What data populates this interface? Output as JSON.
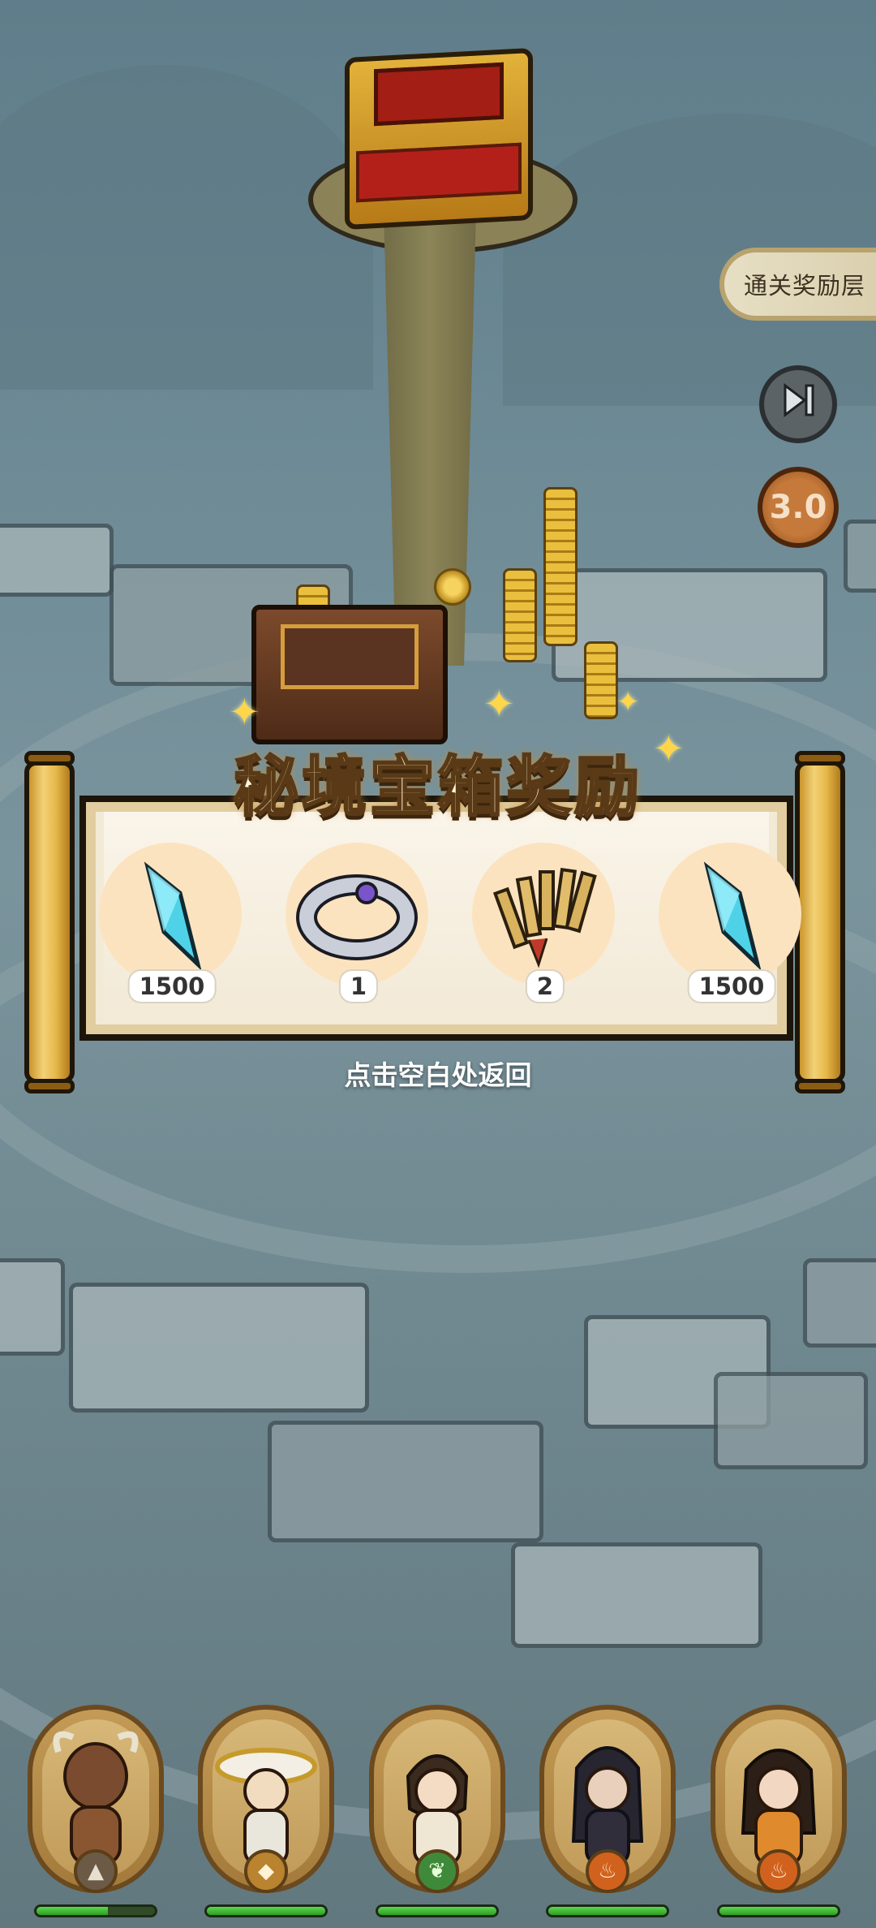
{
  "side_controls": {
    "floor_label": "通关奖励层",
    "skip_icon": "skip-forward-icon",
    "speed": "3.0"
  },
  "reward_panel": {
    "title": "秘境宝箱奖励",
    "return_hint": "点击空白处返回",
    "items": [
      {
        "icon": "crystal-shard-icon",
        "count": "1500"
      },
      {
        "icon": "silver-ring-icon",
        "count": "1"
      },
      {
        "icon": "bamboo-scroll-icon",
        "count": "2"
      },
      {
        "icon": "crystal-shard-icon",
        "count": "1500"
      }
    ]
  },
  "heroes": [
    {
      "name": "minotaur-hero",
      "element_icon": "earth-icon",
      "element_color": "#6b5a46",
      "hp_fraction": 0.6
    },
    {
      "name": "white-hat-hero",
      "element_icon": "wind-icon",
      "element_color": "#b9832f",
      "hp_fraction": 1.0
    },
    {
      "name": "scholar-hero",
      "element_icon": "leaf-icon",
      "element_color": "#3f8a3a",
      "hp_fraction": 1.0
    },
    {
      "name": "dark-swordsman-hero",
      "element_icon": "fire-icon",
      "element_color": "#d1621e",
      "hp_fraction": 1.0
    },
    {
      "name": "fire-maiden-hero",
      "element_icon": "fire-icon",
      "element_color": "#d1621e",
      "hp_fraction": 1.0
    }
  ]
}
